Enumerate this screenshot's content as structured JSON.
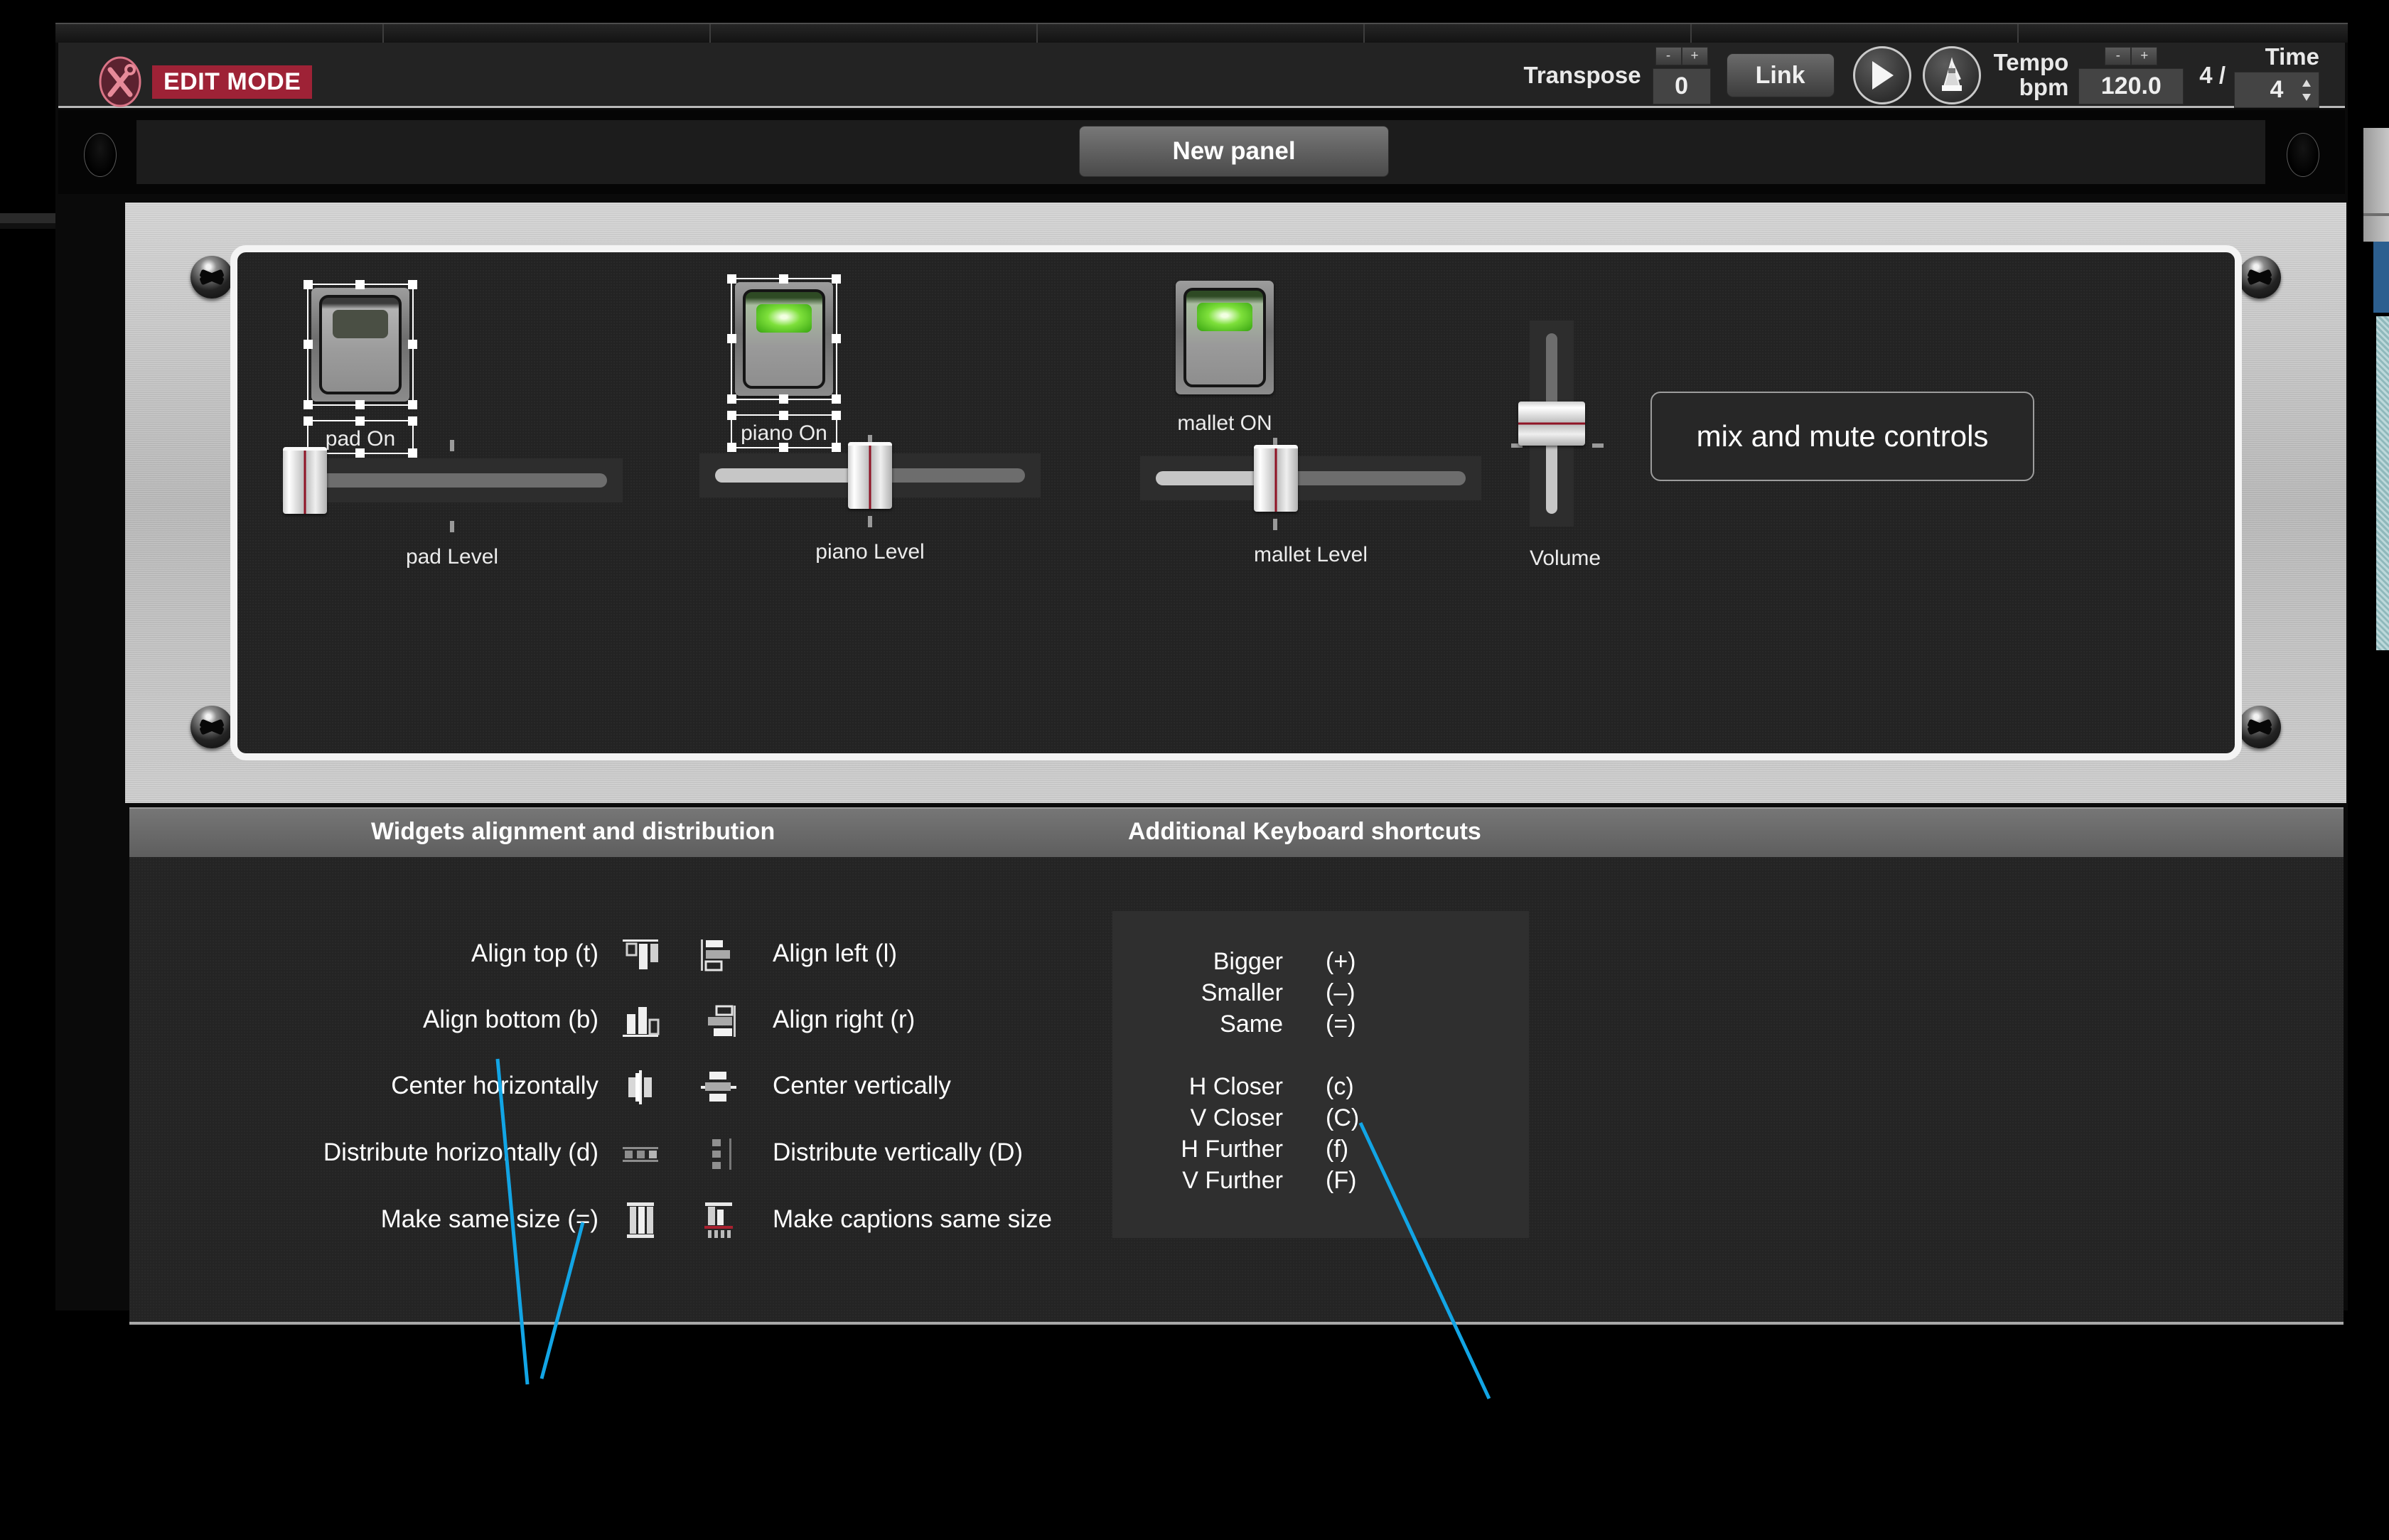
{
  "toolbar": {
    "edit_mode_label": "EDIT MODE",
    "edit_mode_icon": "tools-crossed-icon",
    "transpose_label": "Transpose",
    "transpose_value": "0",
    "stepper_minus": "-",
    "stepper_plus": "+",
    "link_label": "Link",
    "play_icon": "play-icon",
    "metronome_icon": "metronome-icon",
    "tempo_label": "Tempo",
    "tempo_unit": "bpm",
    "tempo_value": "120.0",
    "time_label": "Time",
    "time_numerator": "4 /",
    "time_denominator": "4"
  },
  "tabbar": {
    "tab_label": "New panel"
  },
  "panel": {
    "widgets": [
      {
        "caption": "pad On",
        "type": "toggle",
        "led": "off",
        "selected": true
      },
      {
        "caption": "piano On",
        "type": "toggle",
        "led": "on",
        "selected": true
      },
      {
        "caption": "mallet ON",
        "type": "toggle",
        "led": "on",
        "selected": false
      },
      {
        "caption": "pad Level",
        "type": "hslider",
        "fill_percent": 0
      },
      {
        "caption": "piano Level",
        "type": "hslider",
        "fill_percent": 50
      },
      {
        "caption": "mallet Level",
        "type": "hslider",
        "fill_percent": 43
      },
      {
        "caption": "Volume",
        "type": "vslider",
        "fill_percent": 50
      }
    ],
    "textbox_label": "mix and mute controls"
  },
  "help": {
    "heading_left": "Widgets alignment and distribution",
    "heading_right": "Additional Keyboard shortcuts",
    "left_column": [
      {
        "label": "Align top (t)",
        "icon": "align-top-icon"
      },
      {
        "label": "Align bottom (b)",
        "icon": "align-bottom-icon"
      },
      {
        "label": "Center horizontally",
        "icon": "center-horizontally-icon"
      },
      {
        "label": "Distribute horizontally (d)",
        "icon": "distribute-horizontally-icon"
      },
      {
        "label": "Make same size (=)",
        "icon": "make-same-size-icon"
      }
    ],
    "right_column": [
      {
        "label": "Align left (l)",
        "icon": "align-left-icon"
      },
      {
        "label": "Align right (r)",
        "icon": "align-right-icon"
      },
      {
        "label": "Center vertically",
        "icon": "center-vertically-icon"
      },
      {
        "label": "Distribute vertically (D)",
        "icon": "distribute-vertically-icon"
      },
      {
        "label": "Make captions same size",
        "icon": "make-captions-same-size-icon"
      }
    ],
    "shortcuts": [
      {
        "name": "Bigger",
        "key": "(+)"
      },
      {
        "name": "Smaller",
        "key": "(–)"
      },
      {
        "name": "Same",
        "key": "(=)"
      },
      {
        "name": "H Closer",
        "key": "(c)"
      },
      {
        "name": "V Closer",
        "key": "(C)"
      },
      {
        "name": "H Further",
        "key": "(f)"
      },
      {
        "name": "V Further",
        "key": "(F)"
      }
    ]
  },
  "colors": {
    "edit_badge": "#9e2236",
    "led_on": "#7ee03b",
    "annotation": "#12a5e5",
    "slider_marker": "#8f1325"
  }
}
